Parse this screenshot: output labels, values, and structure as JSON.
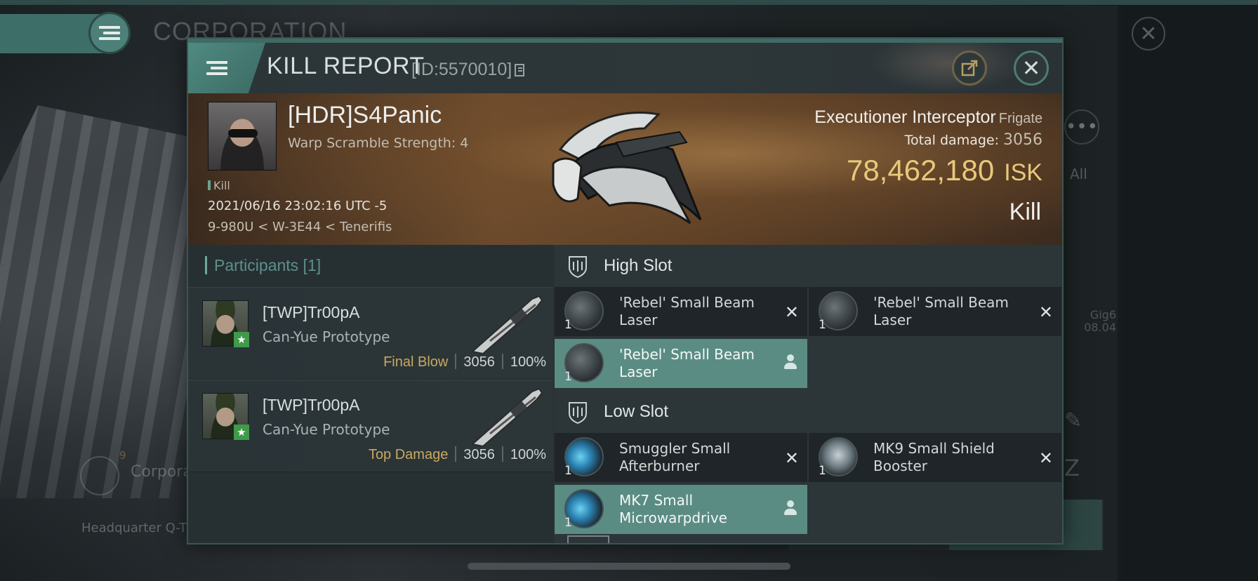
{
  "background": {
    "title": "CORPORATION",
    "side_all_label": "All",
    "side_gig_label": "Gig6",
    "side_gig_date": "08.04",
    "corp_label": "Corpora",
    "corp_count": "9",
    "hq_label": "Headquarter Q-T"
  },
  "header": {
    "title": "KILL REPORT",
    "id_label": "[ID:5570010]"
  },
  "victim": {
    "name": "[HDR]S4Panic",
    "subtitle": "Warp Scramble Strength: 4",
    "tag": "Kill",
    "timestamp": "2021/06/16 23:02:16 UTC -5",
    "location": "9-980U < W-3E44 < Tenerifis",
    "ship_name": "Executioner Interceptor",
    "ship_class": "Frigate",
    "total_damage_label": "Total damage:",
    "total_damage": "3056",
    "isk_value": "78,462,180",
    "isk_unit": "ISK",
    "result": "Kill"
  },
  "participants": {
    "heading": "Participants [1]",
    "rows": [
      {
        "name": "[TWP]Tr00pA",
        "ship": "Can-Yue Prototype",
        "role": "Final Blow",
        "damage": "3056",
        "percent": "100%"
      },
      {
        "name": "[TWP]Tr00pA",
        "ship": "Can-Yue Prototype",
        "role": "Top Damage",
        "damage": "3056",
        "percent": "100%"
      }
    ]
  },
  "slots": {
    "high": {
      "heading": "High Slot",
      "modules": [
        {
          "name": "'Rebel' Small Beam Laser",
          "qty": "1",
          "state": "destroyed",
          "icon": "laser-icon"
        },
        {
          "name": "'Rebel' Small Beam Laser",
          "qty": "1",
          "state": "destroyed",
          "icon": "laser-icon"
        },
        {
          "name": "'Rebel' Small Beam Laser",
          "qty": "1",
          "state": "dropped",
          "icon": "laser-icon"
        }
      ]
    },
    "low": {
      "heading": "Low Slot",
      "modules": [
        {
          "name": "Smuggler Small Afterburner",
          "qty": "1",
          "state": "destroyed",
          "icon": "afterburner-icon"
        },
        {
          "name": "MK9 Small Shield Booster",
          "qty": "1",
          "state": "destroyed",
          "icon": "shield-booster-icon"
        },
        {
          "name": "MK7 Small Microwarpdrive",
          "qty": "1",
          "state": "dropped",
          "icon": "microwarpdrive-icon"
        }
      ]
    }
  },
  "colors": {
    "accent_teal": "#4f8a80",
    "isk_gold": "#e8c97a",
    "role_gold": "#c9a85f",
    "dropped_bg": "#5a8c84"
  }
}
